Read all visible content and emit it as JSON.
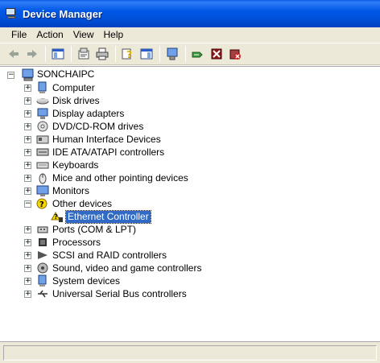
{
  "window": {
    "title": "Device Manager"
  },
  "menu": [
    "File",
    "Action",
    "View",
    "Help"
  ],
  "toolbar": {
    "buttons": [
      "back-icon",
      "forward-icon",
      "show-hide-tree-icon",
      "properties-icon",
      "print-icon",
      "help-icon",
      "show-hide-action-pane-icon",
      "scan-hardware-icon",
      "update-driver-icon",
      "disable-device-icon",
      "uninstall-device-icon"
    ]
  },
  "tree": {
    "root": "SONCHAIPC",
    "categories": [
      "Computer",
      "Disk drives",
      "Display adapters",
      "DVD/CD-ROM drives",
      "Human Interface Devices",
      "IDE ATA/ATAPI controllers",
      "Keyboards",
      "Mice and other pointing devices",
      "Monitors",
      "Other devices",
      "Ports (COM & LPT)",
      "Processors",
      "SCSI and RAID controllers",
      "Sound, video and game controllers",
      "System devices",
      "Universal Serial Bus controllers"
    ],
    "other_devices_child": "Ethernet Controller",
    "selected": "Ethernet Controller"
  },
  "colors": {
    "title_bar": "#0055e5",
    "selection": "#316ac5",
    "chrome": "#ece9d8"
  }
}
